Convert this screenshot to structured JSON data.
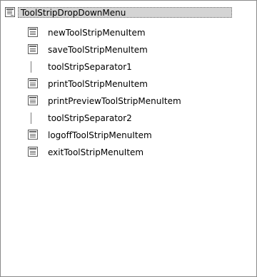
{
  "tree": {
    "root": {
      "label": "ToolStripDropDownMenu",
      "icon": "menu-component-icon"
    },
    "children": [
      {
        "label": "newToolStripMenuItem",
        "kind": "menu-item",
        "icon": "menu-item-icon"
      },
      {
        "label": "saveToolStripMenuItem",
        "kind": "menu-item",
        "icon": "menu-item-icon"
      },
      {
        "label": "toolStripSeparator1",
        "kind": "separator",
        "icon": "separator-line-icon"
      },
      {
        "label": "printToolStripMenuItem",
        "kind": "menu-item",
        "icon": "menu-item-icon"
      },
      {
        "label": "printPreviewToolStripMenuItem",
        "kind": "menu-item",
        "icon": "menu-item-icon"
      },
      {
        "label": "toolStripSeparator2",
        "kind": "separator",
        "icon": "separator-line-icon"
      },
      {
        "label": "logoffToolStripMenuItem",
        "kind": "menu-item",
        "icon": "menu-item-icon"
      },
      {
        "label": "exitToolStripMenuItem",
        "kind": "menu-item",
        "icon": "menu-item-icon"
      }
    ]
  }
}
